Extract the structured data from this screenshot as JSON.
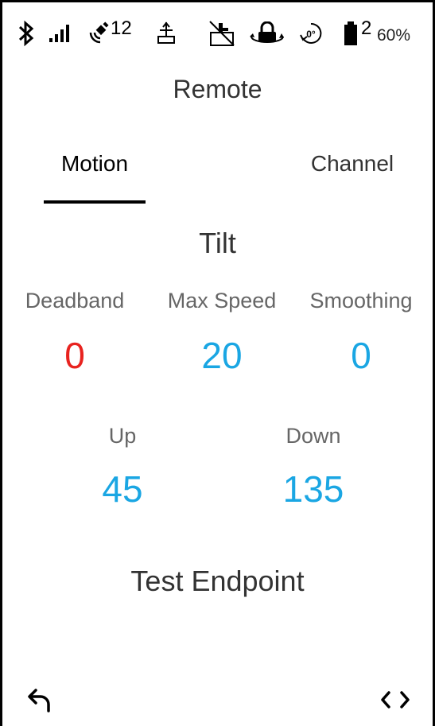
{
  "status_bar": {
    "satellites": "12",
    "battery_index": "2",
    "battery_percent": "60%",
    "orientation": "0°",
    "icons": [
      "bluetooth-icon",
      "signal-bars-icon",
      "satellite-icon",
      "antenna-icon",
      "tilt-off-icon",
      "lock-rotate-icon",
      "orientation-icon",
      "battery-icon"
    ]
  },
  "header": {
    "title": "Remote"
  },
  "tabs": [
    {
      "label": "Motion",
      "active": true
    },
    {
      "label": "Channel",
      "active": false
    }
  ],
  "section": {
    "title": "Tilt"
  },
  "params": [
    {
      "label": "Deadband",
      "value": "0",
      "color": "#e8231f"
    },
    {
      "label": "Max Speed",
      "value": "20",
      "color": "#1aa6e3"
    },
    {
      "label": "Smoothing",
      "value": "0",
      "color": "#1aa6e3"
    }
  ],
  "limits": [
    {
      "label": "Up",
      "value": "45",
      "color": "#1aa6e3"
    },
    {
      "label": "Down",
      "value": "135",
      "color": "#1aa6e3"
    }
  ],
  "actions": {
    "test_endpoint": "Test Endpoint"
  },
  "nav": {
    "back_icon": "back-arrow-icon",
    "switch_icon": "chevrons-icon"
  }
}
